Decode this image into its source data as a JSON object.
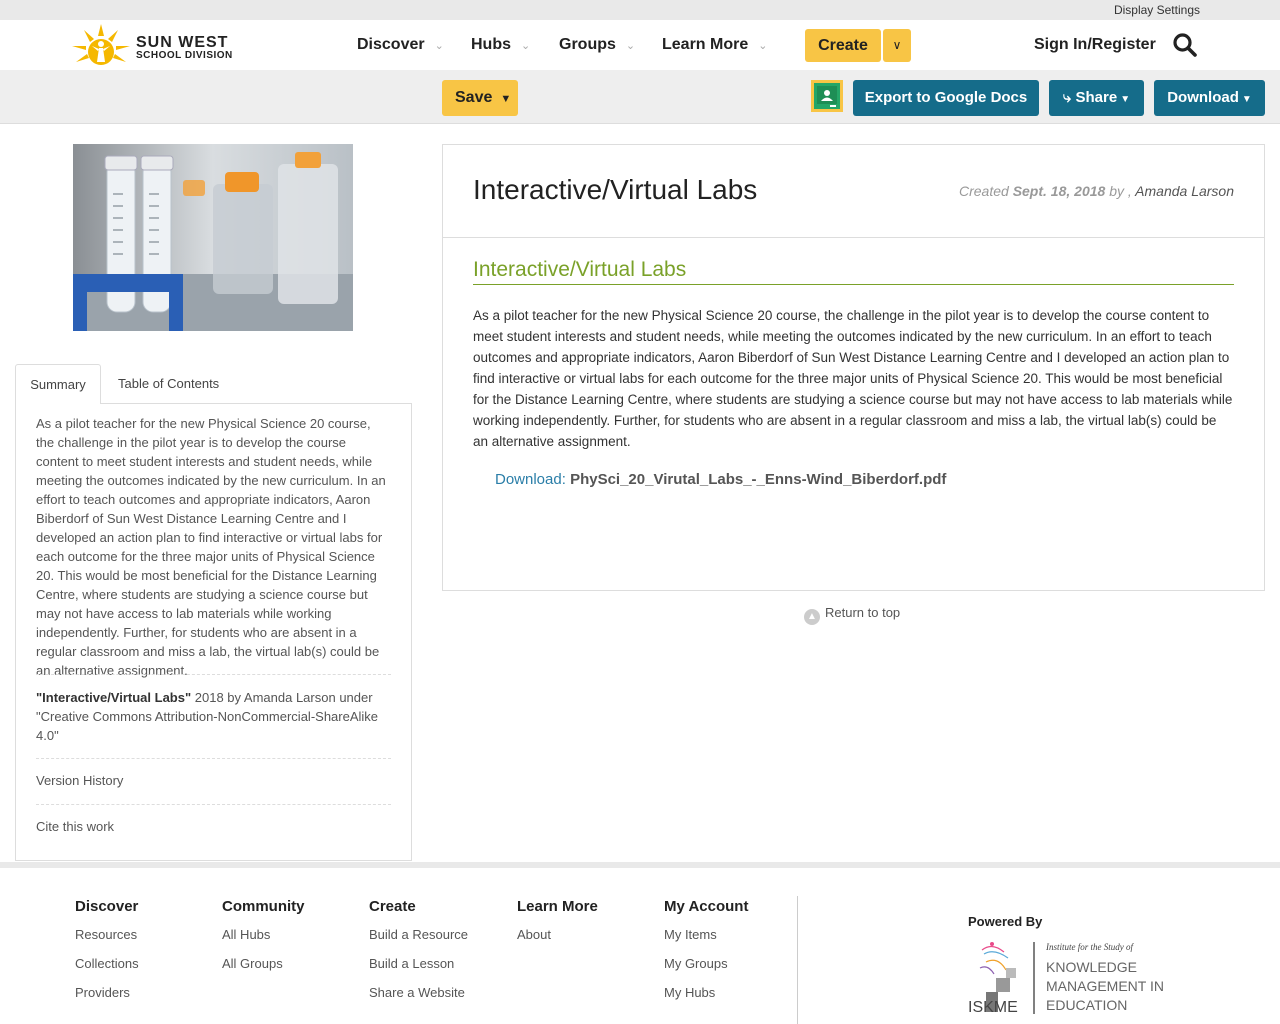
{
  "topbar": {
    "display_settings": "Display Settings"
  },
  "brand": {
    "line1": "SUN WEST",
    "line2": "SCHOOL DIVISION"
  },
  "nav": {
    "items": [
      {
        "label": "Discover"
      },
      {
        "label": "Hubs"
      },
      {
        "label": "Groups"
      },
      {
        "label": "Learn More"
      }
    ],
    "create_label": "Create",
    "signin_label": "Sign In/Register"
  },
  "toolbar": {
    "save_label": "Save",
    "export_label": "Export to Google Docs",
    "share_label": "Share",
    "download_label": "Download"
  },
  "sidebar": {
    "tabs": [
      "Summary",
      "Table of Contents"
    ],
    "summary": "As a pilot teacher for the new Physical Science 20 course, the challenge in the pilot year is to develop the course content to meet student interests and student needs, while meeting the outcomes indicated by the new curriculum. In an effort to teach outcomes and appropriate indicators, Aaron Biberdorf of Sun West Distance Learning Centre and I developed an action plan to find interactive or virtual labs for each outcome for the three major units of Physical Science 20. This would be most beneficial for the Distance Learning Centre, where students are studying a science course but may not have access to lab materials while working independently. Further, for students who are absent in a regular classroom and miss a lab, the virtual lab(s) could be an alternative assignment.",
    "attribution_title": "\"Interactive/Virtual Labs\"",
    "attribution_rest": " 2018 by Amanda Larson under \"Creative Commons Attribution-NonCommercial-ShareAlike 4.0\"",
    "version_history": "Version History",
    "cite": "Cite this work"
  },
  "main": {
    "title": "Interactive/Virtual Labs",
    "created_label": "Created",
    "created_date": "Sept. 18, 2018",
    "by_label": "by ,",
    "author": "Amanda Larson",
    "section_title": "Interactive/Virtual Labs",
    "body": "As a pilot teacher for the new Physical Science 20 course, the challenge in the pilot year is to develop the course content to meet student interests and student needs, while meeting the outcomes indicated by the new curriculum. In an effort to teach outcomes and appropriate indicators, Aaron Biberdorf of Sun West Distance Learning Centre and I developed an action plan to find interactive or virtual labs for each outcome for the three major units of Physical Science 20. This would be most beneficial for the Distance Learning Centre, where students are studying a science course but may not have access to lab materials while working independently. Further, for students who are absent in a regular classroom and miss a lab, the virtual lab(s) could be an alternative assignment.",
    "download_label": "Download:",
    "download_file": "PhySci_20_Virutal_Labs_-_Enns-Wind_Biberdorf.pdf",
    "return_top": "Return to top"
  },
  "footer": {
    "columns": [
      {
        "heading": "Discover",
        "links": [
          "Resources",
          "Collections",
          "Providers"
        ]
      },
      {
        "heading": "Community",
        "links": [
          "All Hubs",
          "All Groups"
        ]
      },
      {
        "heading": "Create",
        "links": [
          "Build a Resource",
          "Build a Lesson",
          "Share a Website"
        ]
      },
      {
        "heading": "Learn More",
        "links": [
          "About"
        ]
      },
      {
        "heading": "My Account",
        "links": [
          "My Items",
          "My Groups",
          "My Hubs"
        ]
      }
    ],
    "powered_by": "Powered By",
    "iskme_tagline": "Institute for the Study of",
    "iskme_line1": "KNOWLEDGE",
    "iskme_line2": "MANAGEMENT IN",
    "iskme_line3": "EDUCATION",
    "iskme_abbr": "ISKME"
  },
  "colors": {
    "accent_yellow": "#f8c545",
    "button_blue": "#156c8a",
    "section_green": "#7aa129",
    "link_blue": "#2a7ea8"
  },
  "icons": [
    "sun-logo-icon",
    "chevron-down-icon",
    "search-icon",
    "caret-down-icon",
    "google-classroom-icon",
    "share-icon",
    "arrow-up-circle-icon"
  ]
}
